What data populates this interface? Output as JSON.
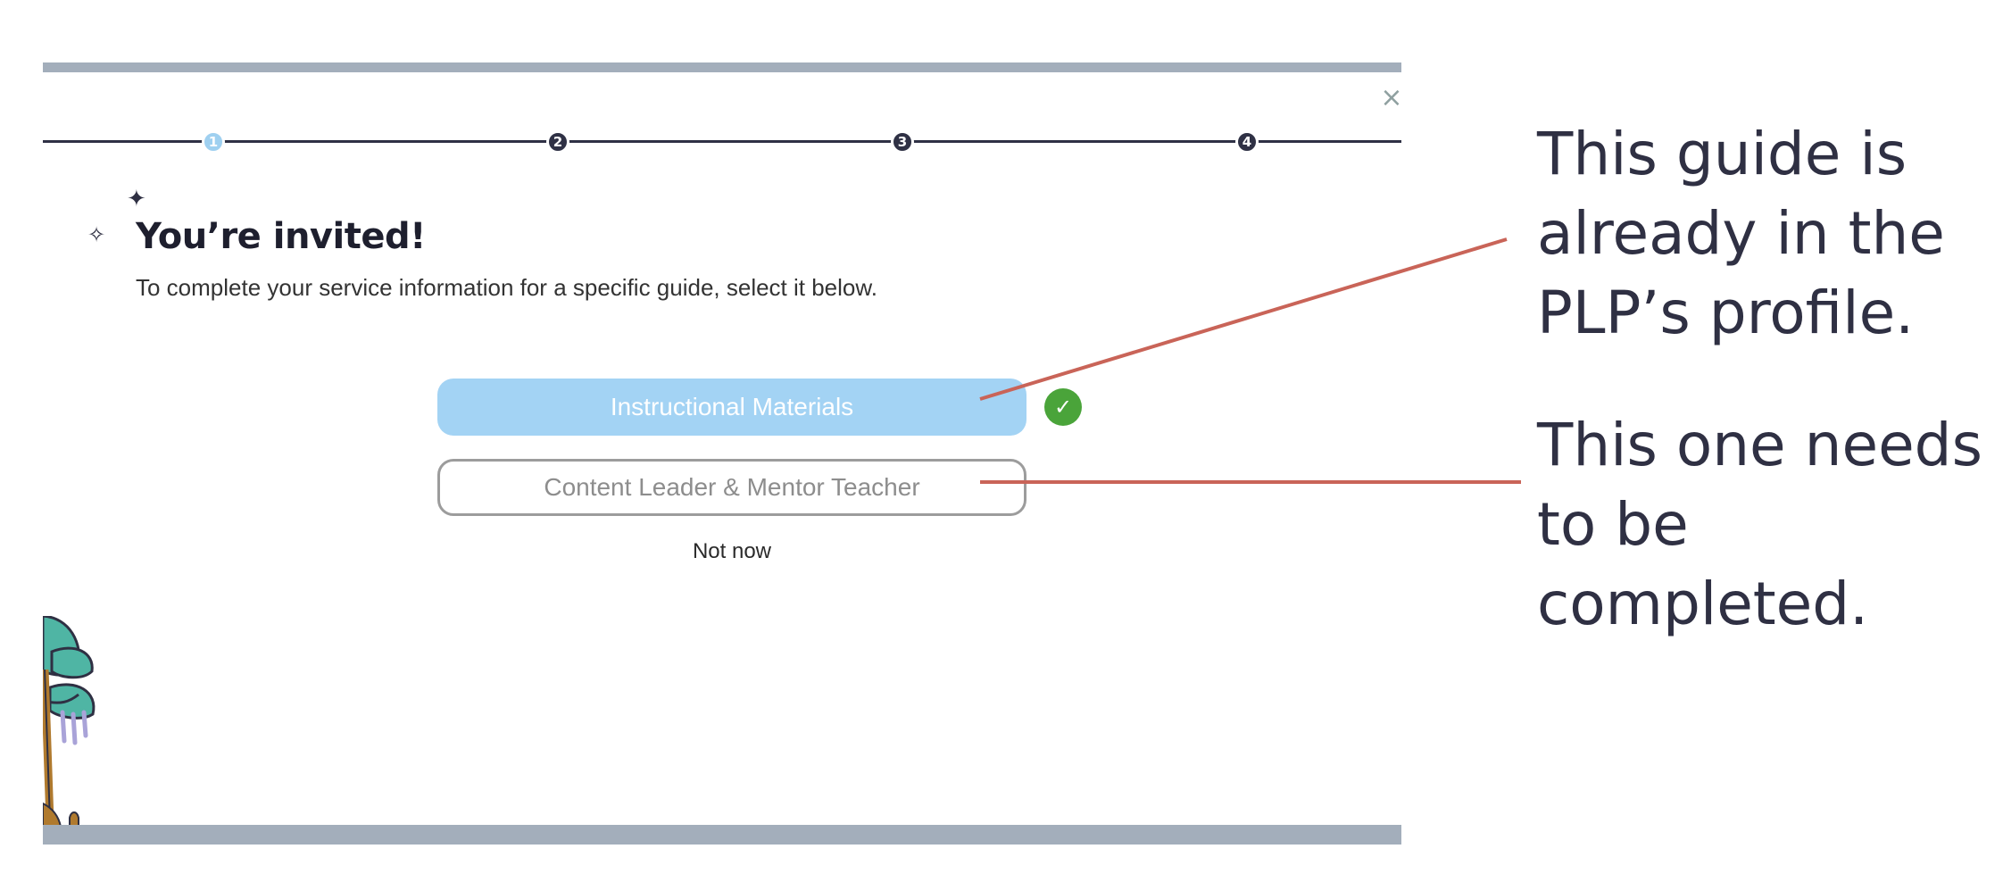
{
  "modal": {
    "close_glyph": "×",
    "stepper": {
      "steps": [
        "1",
        "2",
        "3",
        "4"
      ],
      "active_step": 1
    },
    "title": "You’re invited!",
    "subtitle": "To complete your service information for a specific guide, select it below.",
    "guides": [
      {
        "label": "Instructional Materials",
        "status": "completed"
      },
      {
        "label": "Content Leader & Mentor Teacher",
        "status": "incomplete"
      }
    ],
    "not_now_label": "Not now"
  },
  "annotations": {
    "callout_1": [
      "This guide is",
      "already in the",
      "PLP’s profile."
    ],
    "callout_2": [
      "This one needs",
      "to be completed."
    ]
  },
  "colors": {
    "accent_blue": "#a3d3f4",
    "check_green": "#4aa43a",
    "connector_red": "#c96458",
    "frame_bar": "#a3aebb",
    "text_dark": "#2f3043"
  }
}
